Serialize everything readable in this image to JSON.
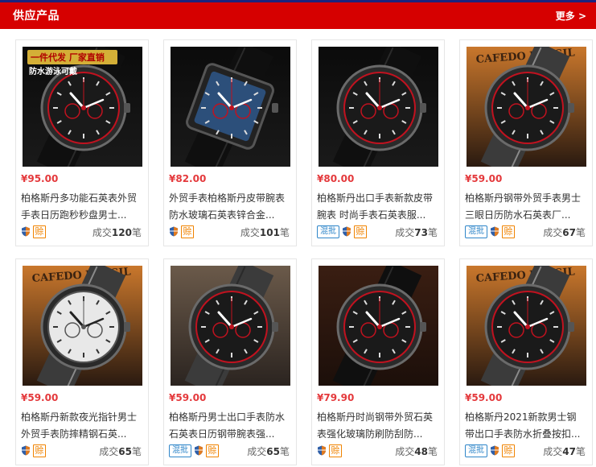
{
  "header": {
    "title": "供应产品",
    "more": "更多 >"
  },
  "products": [
    {
      "price": "¥95.00",
      "title": "柏格斯丹多功能石英表外贸手表日历跑秒秒盘男士...",
      "mix": "",
      "pay": "赊",
      "sold_prefix": "成交",
      "sold_count": "120",
      "sold_suffix": "笔",
      "img_banner": "一件代发 厂家直销",
      "img_sub": "防水游泳可戴"
    },
    {
      "price": "¥82.00",
      "title": "外贸手表柏格斯丹皮带腕表防水玻璃石英表锌合金...",
      "mix": "",
      "pay": "赊",
      "sold_prefix": "成交",
      "sold_count": "101",
      "sold_suffix": "笔",
      "img_banner": "",
      "img_sub": ""
    },
    {
      "price": "¥80.00",
      "title": "柏格斯丹出口手表新款皮带腕表 时尚手表石英表服...",
      "mix": "混批",
      "pay": "赊",
      "sold_prefix": "成交",
      "sold_count": "73",
      "sold_suffix": "笔",
      "img_banner": "",
      "img_sub": ""
    },
    {
      "price": "¥59.00",
      "title": "柏格斯丹钢带外贸手表男士三眼日历防水石英表厂...",
      "mix": "混批",
      "pay": "赊",
      "sold_prefix": "成交",
      "sold_count": "67",
      "sold_suffix": "笔",
      "img_banner": "CAFEDO BRASIL",
      "img_sub": ""
    },
    {
      "price": "¥59.00",
      "title": "柏格斯丹新款夜光指针男士外贸手表防摔精钢石英...",
      "mix": "",
      "pay": "赊",
      "sold_prefix": "成交",
      "sold_count": "65",
      "sold_suffix": "笔",
      "img_banner": "CAFEDO BRASIL",
      "img_sub": ""
    },
    {
      "price": "¥59.00",
      "title": "柏格斯丹男士出口手表防水石英表日历钢带腕表强...",
      "mix": "混批",
      "pay": "赊",
      "sold_prefix": "成交",
      "sold_count": "65",
      "sold_suffix": "笔",
      "img_banner": "",
      "img_sub": ""
    },
    {
      "price": "¥79.90",
      "title": "柏格斯丹时尚钢带外贸石英表强化玻璃防刷防刮防...",
      "mix": "",
      "pay": "赊",
      "sold_prefix": "成交",
      "sold_count": "48",
      "sold_suffix": "笔",
      "img_banner": "",
      "img_sub": ""
    },
    {
      "price": "¥59.00",
      "title": "柏格斯丹2021新款男士钢带出口手表防水折叠按扣...",
      "mix": "混批",
      "pay": "赊",
      "sold_prefix": "成交",
      "sold_count": "47",
      "sold_suffix": "笔",
      "img_banner": "CAFEDO BRASIL",
      "img_sub": ""
    }
  ],
  "colors": {
    "header": "#d60000",
    "price": "#e4393c",
    "mix": "#2f86c9",
    "pay": "#f08300"
  }
}
